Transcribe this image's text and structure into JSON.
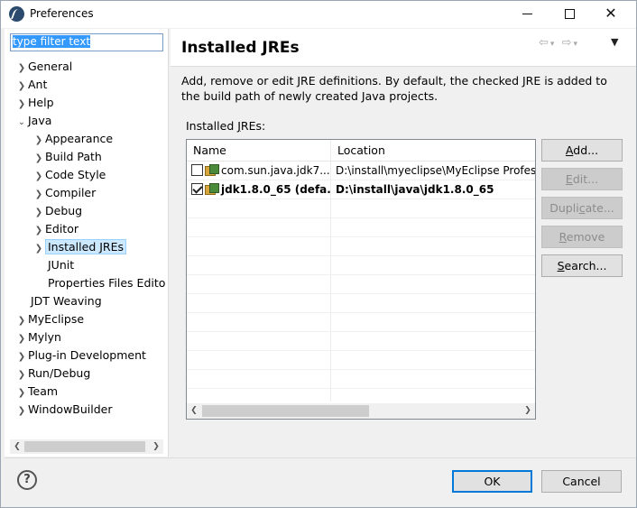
{
  "window": {
    "title": "Preferences"
  },
  "filter": {
    "value": "type filter text"
  },
  "tree": {
    "general": "General",
    "ant": "Ant",
    "help": "Help",
    "java": "Java",
    "appearance": "Appearance",
    "build_path": "Build Path",
    "code_style": "Code Style",
    "compiler": "Compiler",
    "debug": "Debug",
    "editor": "Editor",
    "installed_jres": "Installed JREs",
    "junit": "JUnit",
    "properties_files_editor": "Properties Files Edito",
    "jdt_weaving": "JDT Weaving",
    "myeclipse": "MyEclipse",
    "mylyn": "Mylyn",
    "plugin_development": "Plug-in Development",
    "run_debug": "Run/Debug",
    "team": "Team",
    "windowbuilder": "WindowBuilder"
  },
  "page": {
    "title": "Installed JREs",
    "description": "Add, remove or edit JRE definitions. By default, the checked JRE is added to the build path of newly created Java projects.",
    "table_label_pre": "Installed ",
    "table_label_mnemonic": "J",
    "table_label_post": "REs:"
  },
  "table": {
    "columns": {
      "name": "Name",
      "location": "Location"
    },
    "rows": [
      {
        "name": "com.sun.java.jdk7...",
        "location": "D:\\install\\myeclipse\\MyEclipse Profess",
        "checked": false
      },
      {
        "name": "jdk1.8.0_65 (defa...",
        "location": "D:\\install\\java\\jdk1.8.0_65",
        "checked": true
      }
    ]
  },
  "buttons": {
    "add": {
      "mn": "A",
      "rest": "dd..."
    },
    "edit": {
      "mn": "E",
      "rest": "dit..."
    },
    "duplicate": {
      "pre": "Dupli",
      "mn": "c",
      "rest": "ate..."
    },
    "remove": {
      "mn": "R",
      "rest": "emove"
    },
    "search": {
      "mn": "S",
      "rest": "earch..."
    },
    "ok": "OK",
    "cancel": "Cancel",
    "help": "?"
  }
}
